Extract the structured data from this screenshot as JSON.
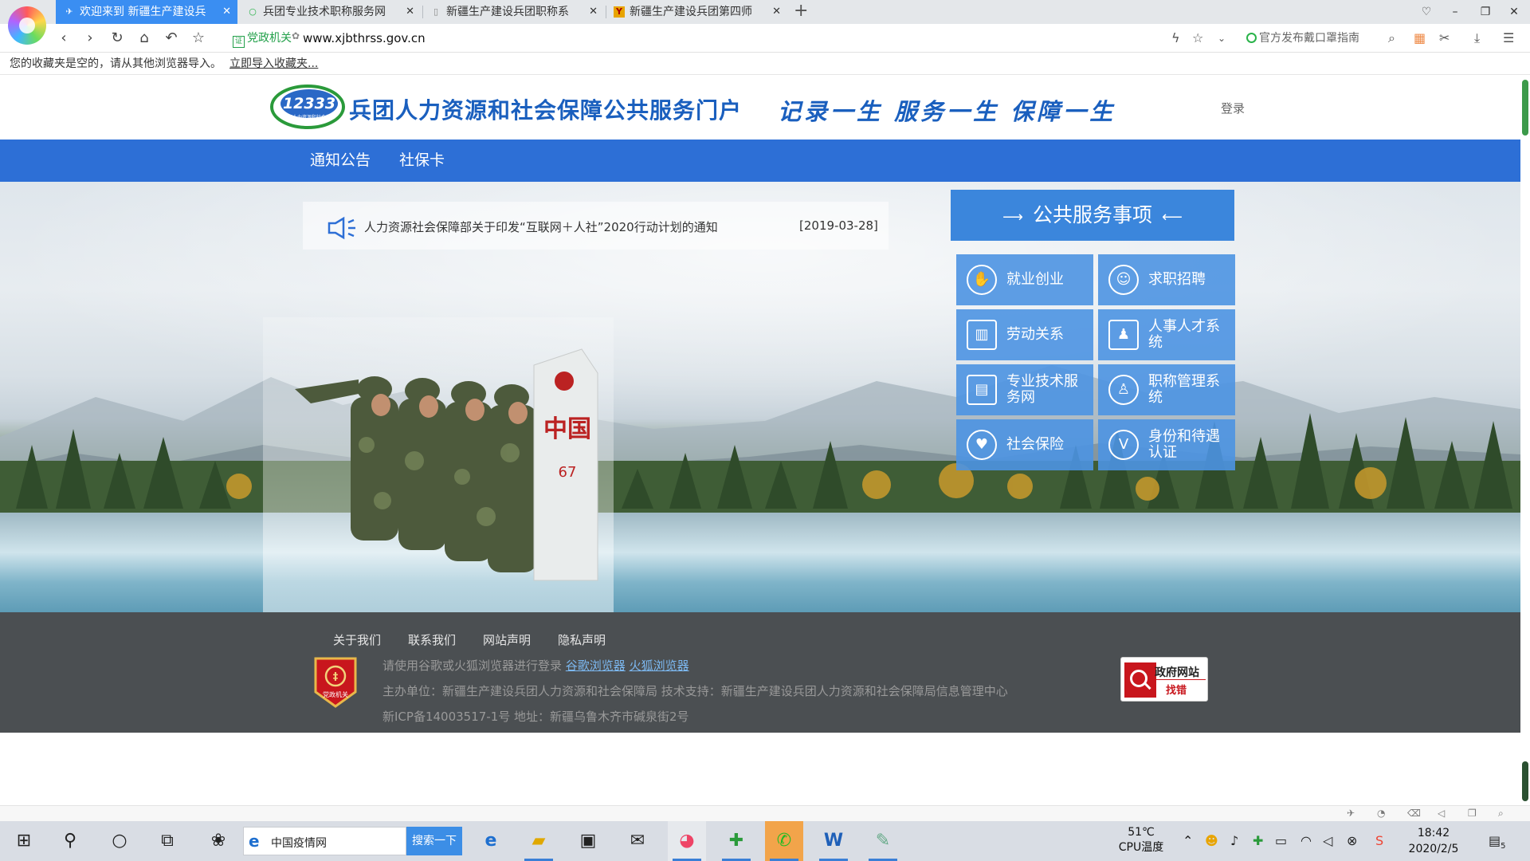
{
  "browser": {
    "tabs": [
      {
        "title": "欢迎来到 新疆生产建设兵",
        "favicon": "page-icon",
        "active": true
      },
      {
        "title": "兵团专业技术职称服务网",
        "favicon": "search-icon",
        "active": false
      },
      {
        "title": "新疆生产建设兵团职称系",
        "favicon": "doc-icon",
        "active": false
      },
      {
        "title": "新疆生产建设兵团第四师",
        "favicon": "y-icon",
        "active": false
      }
    ],
    "gov_badge": "党政机关",
    "url": "www.xjbthrss.gov.cn",
    "toolbar_notice": "官方发布戴口罩指南",
    "favbar_text": "您的收藏夹是空的，请从其他浏览器导入。",
    "favbar_link": "立即导入收藏夹..."
  },
  "site": {
    "logo_text": "12333",
    "logo_sub": "兵团人力资源和社会保障",
    "title": "兵团人力资源和社会保障公共服务门户",
    "slogan": "记录一生 服务一生 保障一生",
    "login": "登录",
    "nav": [
      "通知公告",
      "社保卡"
    ],
    "news": {
      "text": "人力资源社会保障部关于印发“互联网＋人社”2020行动计划的通知",
      "date": "[2019-03-28]"
    },
    "services_title": "公共服务事项",
    "services": [
      {
        "label": "就业创业",
        "icon": "employment-icon"
      },
      {
        "label": "求职招聘",
        "icon": "job-search-icon"
      },
      {
        "label": "劳动关系",
        "icon": "labor-relations-icon"
      },
      {
        "label": "人事人才系统",
        "icon": "talent-system-icon"
      },
      {
        "label": "专业技术服务网",
        "icon": "professional-tech-icon"
      },
      {
        "label": "职称管理系统",
        "icon": "title-management-icon"
      },
      {
        "label": "社会保险",
        "icon": "social-insurance-icon"
      },
      {
        "label": "身份和待遇认证",
        "icon": "identity-verification-icon"
      }
    ],
    "hero_marker": "中国",
    "hero_marker_num": "67",
    "footer": {
      "links": [
        "关于我们",
        "联系我们",
        "网站声明",
        "隐私声明"
      ],
      "badge": "党政机关",
      "browser_hint": "请使用谷歌或火狐浏览器进行登录",
      "chrome_link": "谷歌浏览器",
      "firefox_link": "火狐浏览器",
      "sponsor": "主办单位：新疆生产建设兵团人力资源和社会保障局 技术支持：新疆生产建设兵团人力资源和社会保障局信息管理中心",
      "icp": "新ICP备14003517-1号 地址：新疆乌鲁木齐市碱泉街2号",
      "error_title": "政府网站",
      "error_sub": "找错"
    }
  },
  "taskbar": {
    "search_value": "中国疫情网",
    "search_button": "搜索一下",
    "cpu_temp": "51℃",
    "cpu_label": "CPU温度",
    "time": "18:42",
    "date": "2020/2/5",
    "notification_count": "5"
  },
  "colors": {
    "brand_blue": "#2d6fd6",
    "service_tile": "#4c94e2",
    "footer_bg": "#4b4f52",
    "active_tab": "#3a8ef2"
  }
}
